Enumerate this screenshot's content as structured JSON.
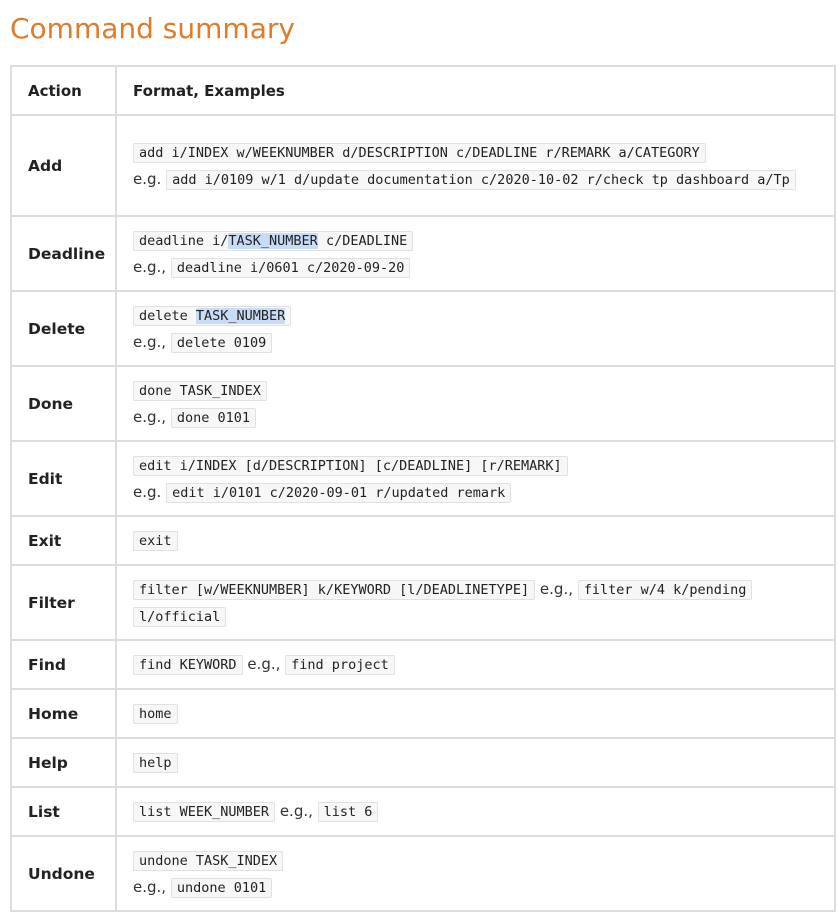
{
  "page": {
    "title": "Command summary"
  },
  "table": {
    "headers": {
      "action": "Action",
      "format": "Format, Examples"
    },
    "rows": {
      "add": {
        "action": "Add",
        "format": "add i/INDEX w/WEEKNUMBER d/DESCRIPTION c/DEADLINE r/REMARK a/CATEGORY",
        "eg": "e.g.",
        "example": "add i/0109 w/1 d/update documentation c/2020-10-02 r/check tp dashboard a/Tp"
      },
      "deadline": {
        "action": "Deadline",
        "format_pre": "deadline i/",
        "format_hl": "TASK_NUMBER",
        "format_post": " c/DEADLINE",
        "eg": "e.g.,",
        "example": "deadline i/0601 c/2020-09-20"
      },
      "delete": {
        "action": "Delete",
        "format_pre": "delete ",
        "format_hl": "TASK_NUMBER",
        "eg": "e.g.,",
        "example": "delete 0109"
      },
      "done": {
        "action": "Done",
        "format": "done TASK_INDEX",
        "eg": "e.g.,",
        "example": "done 0101"
      },
      "edit": {
        "action": "Edit",
        "format": "edit i/INDEX [d/DESCRIPTION] [c/DEADLINE] [r/REMARK]",
        "eg": "e.g.",
        "example": "edit i/0101 c/2020-09-01 r/updated remark"
      },
      "exit": {
        "action": "Exit",
        "format": "exit"
      },
      "filter": {
        "action": "Filter",
        "format": "filter [w/WEEKNUMBER] k/KEYWORD [l/DEADLINETYPE]",
        "eg": "e.g.,",
        "example": "filter w/4 k/pending l/official"
      },
      "find": {
        "action": "Find",
        "format": "find KEYWORD",
        "eg": "e.g.,",
        "example": "find project"
      },
      "home": {
        "action": "Home",
        "format": "home"
      },
      "help": {
        "action": "Help",
        "format": "help"
      },
      "list": {
        "action": "List",
        "format": "list WEEK_NUMBER",
        "eg": "e.g.,",
        "example": "list 6"
      },
      "undone": {
        "action": "Undone",
        "format": "undone TASK_INDEX",
        "eg": "e.g.,",
        "example": "undone 0101"
      }
    }
  },
  "colors": {
    "title": "#e07b2a",
    "border": "#dddddd",
    "code_bg": "#f7f7f7",
    "selection_highlight": "#c8dcf6"
  }
}
